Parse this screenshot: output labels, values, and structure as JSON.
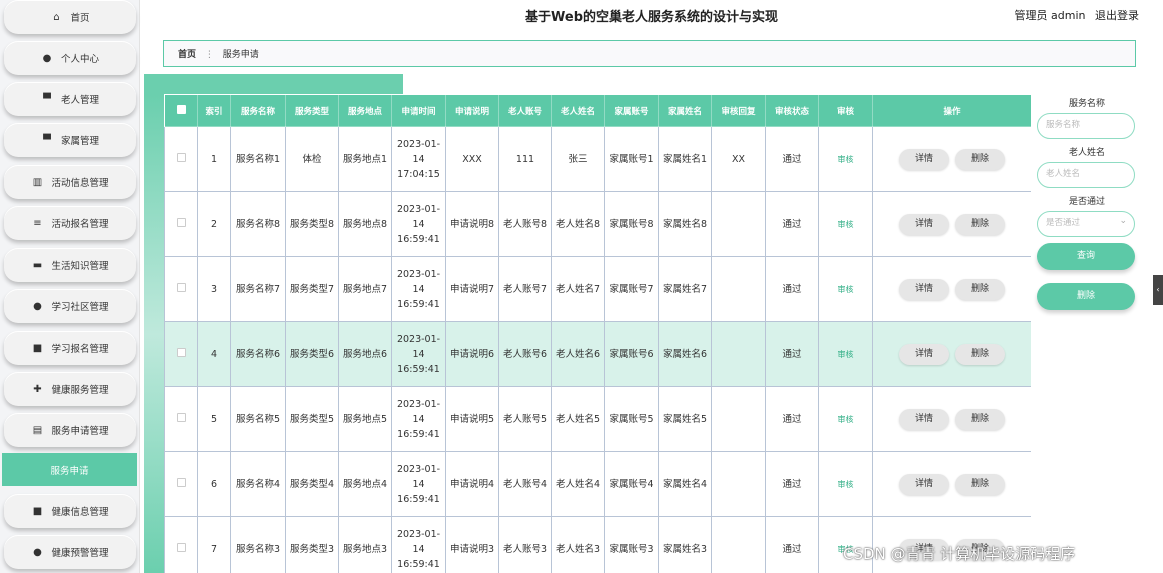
{
  "sidebar": {
    "items": [
      {
        "label": "首页",
        "icon": "home-icon",
        "glyph": "⌂"
      },
      {
        "label": "个人中心",
        "icon": "user-icon",
        "glyph": "●"
      },
      {
        "label": "老人管理",
        "icon": "elder-icon",
        "glyph": "▀"
      },
      {
        "label": "家属管理",
        "icon": "family-icon",
        "glyph": "▀"
      },
      {
        "label": "活动信息管理",
        "icon": "bar-chart-icon",
        "glyph": "▥"
      },
      {
        "label": "活动报名管理",
        "icon": "list-icon",
        "glyph": "≡"
      },
      {
        "label": "生活知识管理",
        "icon": "monitor-icon",
        "glyph": "▬"
      },
      {
        "label": "学习社区管理",
        "icon": "person-icon",
        "glyph": "●"
      },
      {
        "label": "学习报名管理",
        "icon": "grid-icon",
        "glyph": "■"
      },
      {
        "label": "健康服务管理",
        "icon": "health-icon",
        "glyph": "✚"
      },
      {
        "label": "服务申请管理",
        "icon": "doc-icon",
        "glyph": "▤"
      },
      {
        "label": "服务申请",
        "icon": "",
        "glyph": ""
      },
      {
        "label": "健康信息管理",
        "icon": "grid-icon",
        "glyph": "■"
      },
      {
        "label": "健康预警管理",
        "icon": "user-icon",
        "glyph": "●"
      }
    ]
  },
  "header": {
    "title": "基于Web的空巢老人服务系统的设计与实现",
    "user_label": "管理员 admin",
    "logout_label": "退出登录"
  },
  "breadcrumb": {
    "home": "首页",
    "sep": "⋮",
    "current": "服务申请"
  },
  "table": {
    "headers": [
      "",
      "索引",
      "服务名称",
      "服务类型",
      "服务地点",
      "申请时间",
      "申请说明",
      "老人账号",
      "老人姓名",
      "家属账号",
      "家属姓名",
      "审核回复",
      "审核状态",
      "审核",
      "操作"
    ],
    "rows": [
      {
        "index": "1",
        "service_name": "服务名称1",
        "service_type": "体检",
        "location": "服务地点1",
        "time": "2023-01-14 17:04:15",
        "desc": "XXX",
        "elder_acct": "111",
        "elder_name": "张三",
        "family_acct": "家属账号1",
        "family_name": "家属姓名1",
        "reply": "XX",
        "status": "通过",
        "audit": "审核"
      },
      {
        "index": "2",
        "service_name": "服务名称8",
        "service_type": "服务类型8",
        "location": "服务地点8",
        "time": "2023-01-14 16:59:41",
        "desc": "申请说明8",
        "elder_acct": "老人账号8",
        "elder_name": "老人姓名8",
        "family_acct": "家属账号8",
        "family_name": "家属姓名8",
        "reply": "",
        "status": "通过",
        "audit": "审核"
      },
      {
        "index": "3",
        "service_name": "服务名称7",
        "service_type": "服务类型7",
        "location": "服务地点7",
        "time": "2023-01-14 16:59:41",
        "desc": "申请说明7",
        "elder_acct": "老人账号7",
        "elder_name": "老人姓名7",
        "family_acct": "家属账号7",
        "family_name": "家属姓名7",
        "reply": "",
        "status": "通过",
        "audit": "审核"
      },
      {
        "index": "4",
        "service_name": "服务名称6",
        "service_type": "服务类型6",
        "location": "服务地点6",
        "time": "2023-01-14 16:59:41",
        "desc": "申请说明6",
        "elder_acct": "老人账号6",
        "elder_name": "老人姓名6",
        "family_acct": "家属账号6",
        "family_name": "家属姓名6",
        "reply": "",
        "status": "通过",
        "audit": "审核"
      },
      {
        "index": "5",
        "service_name": "服务名称5",
        "service_type": "服务类型5",
        "location": "服务地点5",
        "time": "2023-01-14 16:59:41",
        "desc": "申请说明5",
        "elder_acct": "老人账号5",
        "elder_name": "老人姓名5",
        "family_acct": "家属账号5",
        "family_name": "家属姓名5",
        "reply": "",
        "status": "通过",
        "audit": "审核"
      },
      {
        "index": "6",
        "service_name": "服务名称4",
        "service_type": "服务类型4",
        "location": "服务地点4",
        "time": "2023-01-14 16:59:41",
        "desc": "申请说明4",
        "elder_acct": "老人账号4",
        "elder_name": "老人姓名4",
        "family_acct": "家属账号4",
        "family_name": "家属姓名4",
        "reply": "",
        "status": "通过",
        "audit": "审核"
      },
      {
        "index": "7",
        "service_name": "服务名称3",
        "service_type": "服务类型3",
        "location": "服务地点3",
        "time": "2023-01-14 16:59:41",
        "desc": "申请说明3",
        "elder_acct": "老人账号3",
        "elder_name": "老人姓名3",
        "family_acct": "家属账号3",
        "family_name": "家属姓名3",
        "reply": "",
        "status": "通过",
        "audit": "审核"
      }
    ],
    "detail_label": "详情",
    "delete_label": "删除"
  },
  "search": {
    "service_name_label": "服务名称",
    "service_name_placeholder": "服务名称",
    "elder_name_label": "老人姓名",
    "elder_name_placeholder": "老人姓名",
    "approved_label": "是否通过",
    "approved_placeholder": "是否通过",
    "query_label": "查询",
    "delete_label": "删除"
  },
  "watermark": "CSDN @青青  计算机毕设源码程序",
  "colors": {
    "accent": "#5cc9a7",
    "highlight_row": "#d8f2ea"
  }
}
